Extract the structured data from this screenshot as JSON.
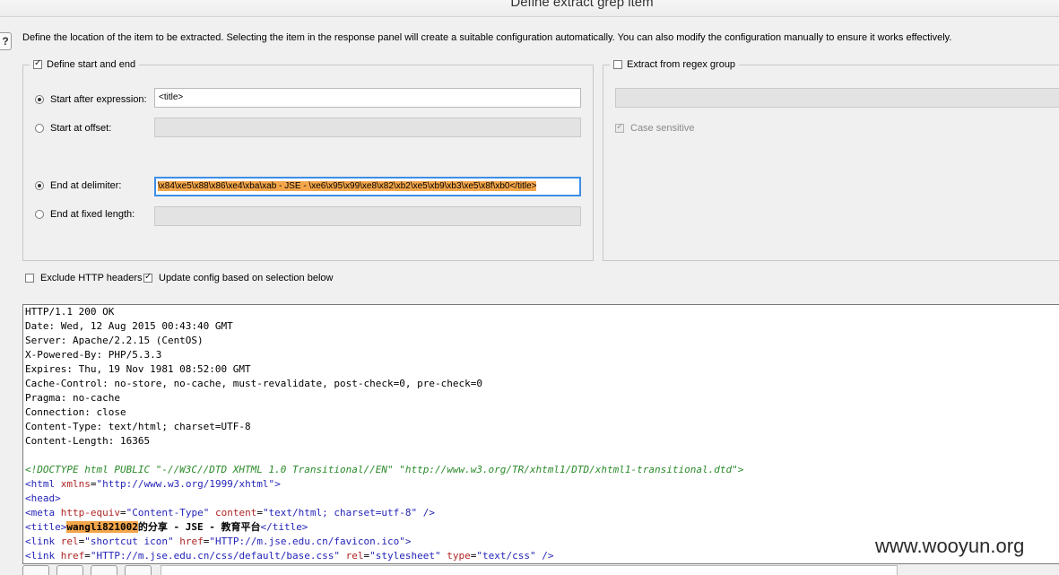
{
  "dialog": {
    "title": "Define extract grep item",
    "help_label": "?"
  },
  "description": "Define the location of the item to be extracted. Selecting the item in the response panel will create a suitable configuration automatically. You can also modify the configuration manually to ensure it works effectively.",
  "left_group": {
    "legend": "Define start and end",
    "checked": true,
    "start_after_label": "Start after expression:",
    "start_after_value": "<title>",
    "start_offset_label": "Start at offset:",
    "start_offset_value": "",
    "end_delim_label": "End at delimiter:",
    "end_delim_value": "\\x84\\xe5\\x88\\x86\\xe4\\xba\\xab - JSE - \\xe6\\x95\\x99\\xe8\\x82\\xb2\\xe5\\xb9\\xb3\\xe5\\x8f\\xb0</title>",
    "end_fixed_label": "End at fixed length:",
    "end_fixed_value": ""
  },
  "right_group": {
    "legend": "Extract from regex group",
    "checked": false,
    "regex_value": "",
    "case_sensitive_label": "Case sensitive",
    "case_sensitive_checked": true
  },
  "options": {
    "exclude_headers_label": "Exclude HTTP headers",
    "exclude_headers_checked": false,
    "update_config_label": "Update config based on selection below",
    "update_config_checked": true
  },
  "response": {
    "headers": [
      "HTTP/1.1 200 OK",
      "Date: Wed, 12 Aug 2015 00:43:40 GMT",
      "Server: Apache/2.2.15 (CentOS)",
      "X-Powered-By: PHP/5.3.3",
      "Expires: Thu, 19 Nov 1981 08:52:00 GMT",
      "Cache-Control: no-store, no-cache, must-revalidate, post-check=0, pre-check=0",
      "Pragma: no-cache",
      "Connection: close",
      "Content-Type: text/html; charset=UTF-8",
      "Content-Length: 16365"
    ],
    "doctype": "<!DOCTYPE html PUBLIC \"-//W3C//DTD XHTML 1.0 Transitional//EN\" \"http://www.w3.org/TR/xhtml1/DTD/xhtml1-transitional.dtd\">",
    "html_open": "<html",
    "html_attr": "xmlns",
    "html_val": "\"http://www.w3.org/1999/xhtml\"",
    "head": "<head>",
    "meta_open": "<meta",
    "meta_attr1": "http-equiv",
    "meta_val1": "\"Content-Type\"",
    "meta_attr2": "content",
    "meta_val2": "\"text/html; charset=utf-8\"",
    "meta_close": "/>",
    "title_open": "<title>",
    "title_selected": "wangli821002",
    "title_rest": "的分享 - JSE - 教育平台",
    "title_close": "</title>",
    "link1_open": "<link",
    "link1_attr1": "rel",
    "link1_val1": "\"shortcut icon\"",
    "link1_attr2": "href",
    "link1_val2": "\"HTTP://m.jse.edu.cn/favicon.ico\"",
    "link1_close": ">",
    "link2_open": "<link",
    "link2_attr1": "href",
    "link2_val1": "\"HTTP://m.jse.edu.cn/css/default/base.css\"",
    "link2_attr2": "rel",
    "link2_val2": "\"stylesheet\"",
    "link2_attr3": "type",
    "link2_val3": "\"text/css\"",
    "link2_close": "/>"
  },
  "watermark": "www.wooyun.org"
}
